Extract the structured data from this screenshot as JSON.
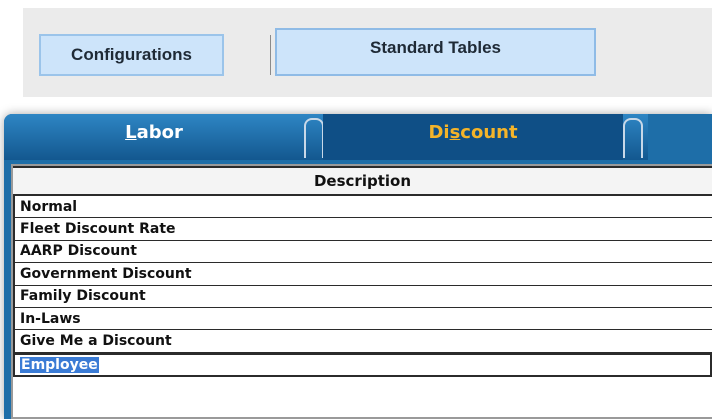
{
  "toolbar": {
    "configurations_label": "Configurations",
    "standard_tables_label": "Standard Tables"
  },
  "tabs": [
    {
      "label_prefix": "",
      "mnemonic": "L",
      "label_suffix": "abor",
      "active": false
    },
    {
      "label_prefix": "Di",
      "mnemonic": "s",
      "label_suffix": "count",
      "active": true
    }
  ],
  "grid": {
    "column_header": "Description",
    "rows": [
      "Normal",
      "Fleet Discount Rate",
      "AARP Discount",
      "Government Discount",
      "Family Discount",
      "In-Laws",
      "Give Me a Discount",
      "Employee"
    ],
    "selected_row": "Employee"
  },
  "colors": {
    "tab_strip": "#1e6ea8",
    "active_tab_text": "#f4b42a",
    "button_fill": "#cde4fa",
    "selection": "#3a7bd5"
  }
}
